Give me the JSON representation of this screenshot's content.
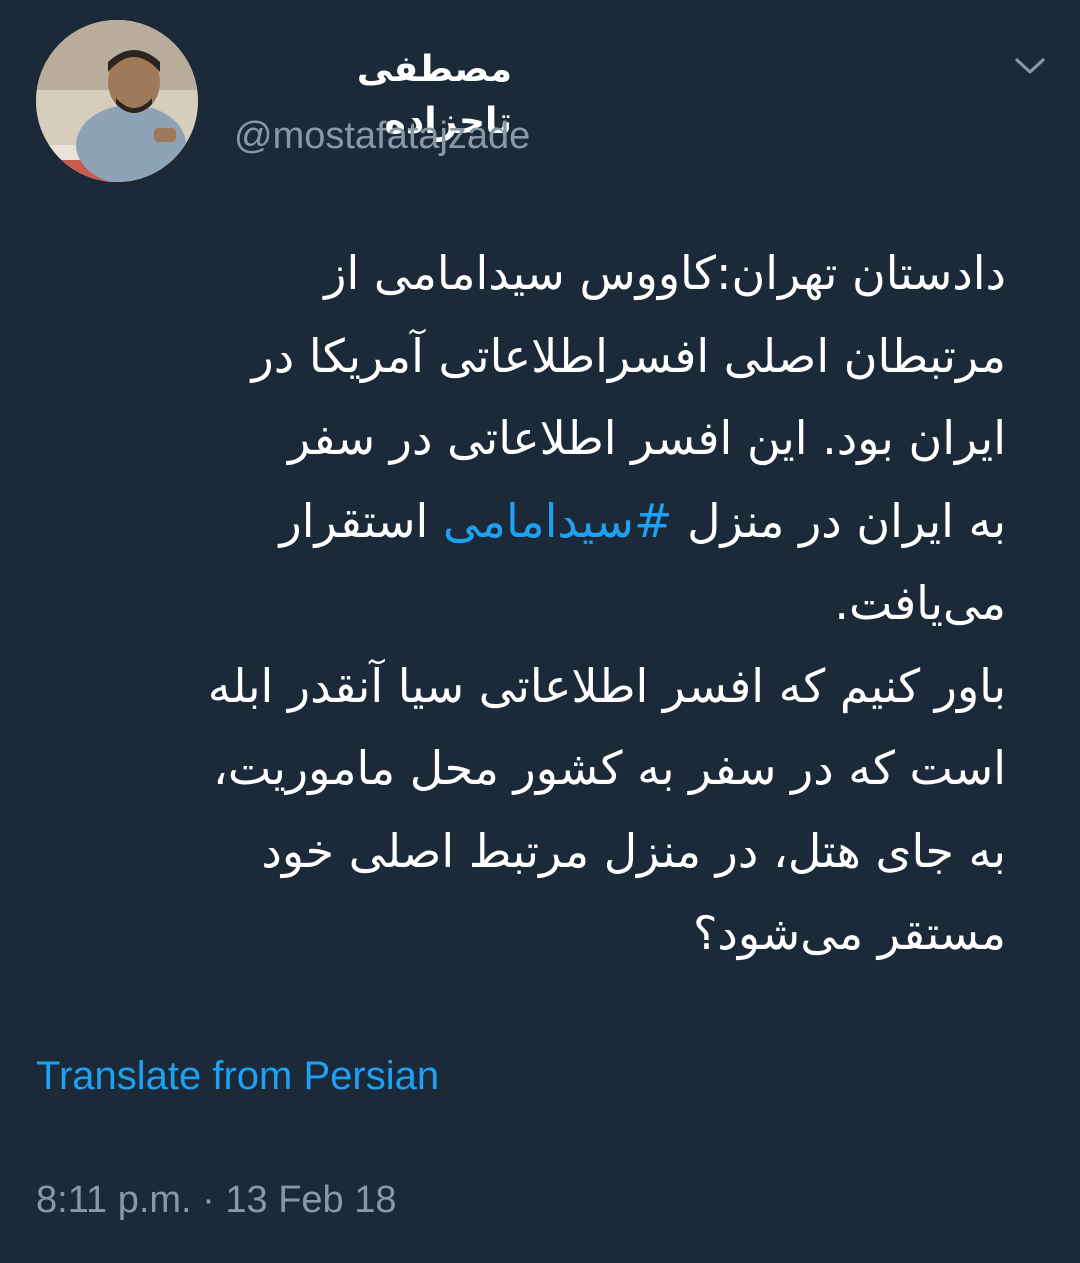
{
  "tweet": {
    "display_name": "مصطفی تاجزاده",
    "handle": "@mostafatajzade",
    "avatar_icon": "profile-photo",
    "caret_icon": "chevron-down-icon",
    "body_lines": [
      "دادستان تهران:کاووس سیدامامی از",
      "مرتبطان اصلی افسراطلاعاتی آمریکا در",
      "ایران بود. این افسر اطلاعاتی در سفر",
      {
        "before": "به ایران در منزل ",
        "hashtag": "#سیدامامی",
        "after": " استقرار"
      },
      "می‌یافت.",
      "باور کنیم که افسر اطلاعاتی سیا آنقدر ابله",
      "است که در سفر به کشور محل ماموریت،",
      "به جای هتل، در منزل مرتبط اصلی خود",
      "مستقر می‌شود؟"
    ],
    "translate_label": "Translate from Persian",
    "timestamp": "8:11 p.m. · 13 Feb 18",
    "colors": {
      "background": "#1c2938",
      "text": "#ffffff",
      "secondary": "#8899a6",
      "accent": "#1da1f2"
    }
  }
}
